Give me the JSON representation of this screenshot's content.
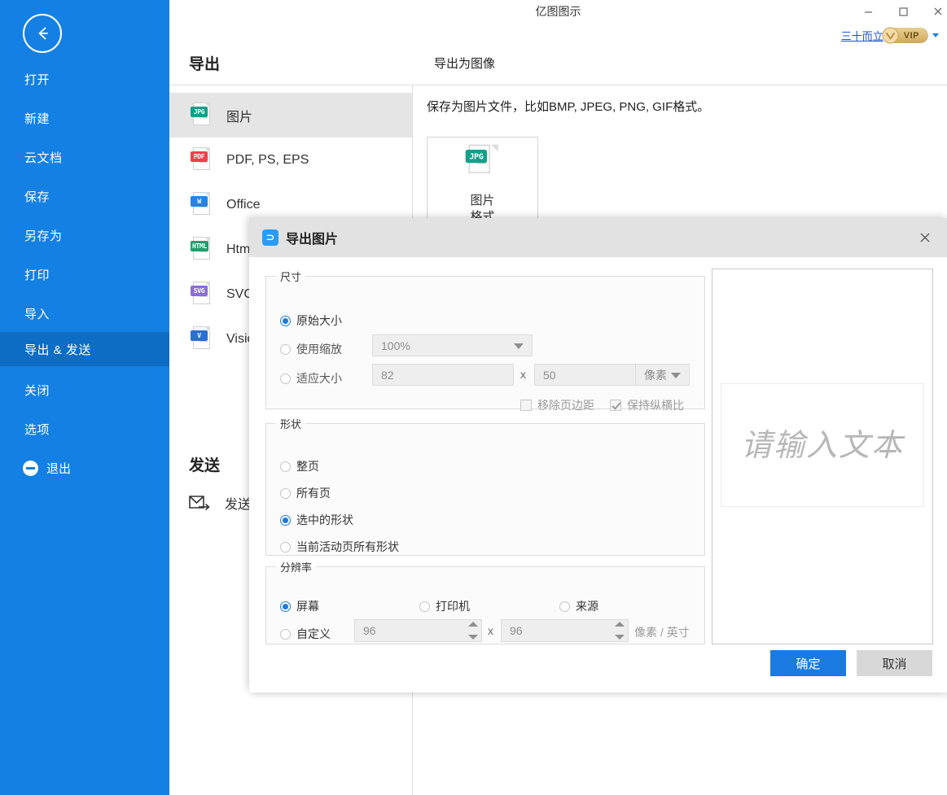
{
  "window": {
    "app_title": "亿图图示",
    "minimize_label": "–",
    "maximize_label": "□",
    "close_label": "✕"
  },
  "account": {
    "user_name": "三十而立",
    "vip_label": "VIP"
  },
  "sidebar": {
    "back_label": "返回",
    "items": [
      {
        "label": "打开"
      },
      {
        "label": "新建"
      },
      {
        "label": "云文档"
      },
      {
        "label": "保存"
      },
      {
        "label": "另存为"
      },
      {
        "label": "打印"
      },
      {
        "label": "导入"
      },
      {
        "label": "导出 & 发送"
      },
      {
        "label": "关闭"
      },
      {
        "label": "选项"
      }
    ],
    "active_index": 7,
    "exit_label": "退出"
  },
  "export_pane": {
    "heading": "导出",
    "sub_heading": "导出为图像",
    "description": "保存为图片文件，比如BMP, JPEG, PNG, GIF格式。",
    "format_card": {
      "tag": "JPG",
      "line1": "图片",
      "line2": "格式"
    },
    "file_types": [
      {
        "tag": "JPG",
        "label": "图片",
        "color": "#12a08a"
      },
      {
        "tag": "PDF",
        "label": "PDF, PS, EPS",
        "color": "#f0404a"
      },
      {
        "tag": "W",
        "label": "Office",
        "color": "#2b82e0"
      },
      {
        "tag": "HTML",
        "label": "Html",
        "color": "#1ea06a"
      },
      {
        "tag": "SVG",
        "label": "SVG",
        "color": "#8a6fd0"
      },
      {
        "tag": "V",
        "label": "Visio",
        "color": "#2b6fd0"
      }
    ],
    "active_file_type": 0,
    "send_heading": "发送",
    "send_item_label": "发送"
  },
  "dialog": {
    "title": "导出图片",
    "logo_glyph": "⊃",
    "close_label": "✕",
    "size_group": {
      "legend": "尺寸",
      "option_original": "原始大小",
      "option_scale": "使用缩放",
      "option_fit": "适应大小",
      "selected": "原始大小",
      "scale_value": "100%",
      "fit_width": "82",
      "fit_height": "50",
      "multiply_symbol": "x",
      "unit_value": "像素",
      "remove_margin_label": "移除页边距",
      "remove_margin_checked": false,
      "keep_ratio_label": "保持纵横比",
      "keep_ratio_checked": true
    },
    "shape_group": {
      "legend": "形状",
      "options": [
        "整页",
        "所有页",
        "选中的形状",
        "当前活动页所有形状"
      ],
      "selected_index": 2
    },
    "resolution_group": {
      "legend": "分辨率",
      "options": [
        "屏幕",
        "打印机",
        "来源"
      ],
      "selected_index": 0,
      "custom_label": "自定义",
      "custom_x": "96",
      "custom_y": "96",
      "multiply_symbol": "x",
      "unit_label": "像素 / 英寸"
    },
    "preview": {
      "placeholder_text": "请输入文本"
    },
    "buttons": {
      "ok": "确定",
      "cancel": "取消"
    }
  },
  "colors": {
    "sidebar_bg": "#1480e4",
    "sidebar_active": "#0d6cc4",
    "accent": "#1a7ae0",
    "dialog_titlebar": "#e2e2e2",
    "vip_gold": "#cfa95c"
  }
}
